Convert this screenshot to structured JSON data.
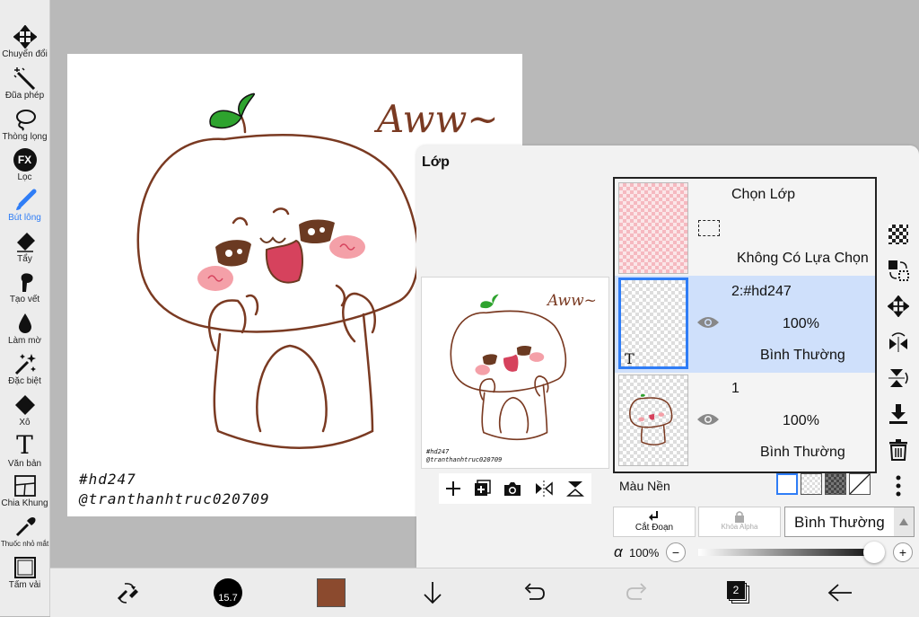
{
  "toolbar": {
    "items": [
      {
        "label": "Chuyển đổi",
        "icon": "move-icon"
      },
      {
        "label": "Đũa phép",
        "icon": "magic-wand-icon"
      },
      {
        "label": "Thòng lọng",
        "icon": "lasso-icon"
      },
      {
        "label": "Lọc",
        "icon": "fx-filter-icon"
      },
      {
        "label": "Bút lông",
        "icon": "brush-icon",
        "active": true
      },
      {
        "label": "Tẩy",
        "icon": "eraser-icon"
      },
      {
        "label": "Tạo vết",
        "icon": "smudge-icon"
      },
      {
        "label": "Làm mờ",
        "icon": "blur-drop-icon"
      },
      {
        "label": "Đặc biệt",
        "icon": "special-sparkle-icon"
      },
      {
        "label": "Xô",
        "icon": "bucket-icon"
      },
      {
        "label": "Văn bản",
        "icon": "text-icon"
      },
      {
        "label": "Chia Khung",
        "icon": "frame-divider-icon"
      },
      {
        "label": "Thuốc nhỏ mắt",
        "icon": "eyedropper-icon"
      },
      {
        "label": "Tấm vải",
        "icon": "canvas-icon"
      }
    ],
    "fx_text": "FX",
    "text_glyph": "T",
    "active_color": "#2f7df6"
  },
  "canvas": {
    "drawing_text": "Aww~",
    "signature_line1": "#hd247",
    "signature_line2": "@tranthanhtruc020709",
    "line_color": "#7a3a22",
    "leaf_color": "#2ea32e",
    "cheek_color": "#f4a0a8",
    "mouth_color": "#d6425d",
    "eye_color": "#6b3a22"
  },
  "layer_panel": {
    "title": "Lớp",
    "preview": {
      "drawing_text": "Aww~",
      "signature_line1": "#hd247",
      "signature_line2": "@tranthanhtruc020709"
    },
    "selection_row": {
      "title": "Chọn Lớp",
      "status": "Không Có Lựa Chọn"
    },
    "layers": [
      {
        "name": "2:#hd247",
        "opacity": "100%",
        "blend": "Bình Thường",
        "selected": true,
        "thumb_glyph": "T"
      },
      {
        "name": "1",
        "opacity": "100%",
        "blend": "Bình Thường",
        "selected": false
      }
    ],
    "background_label": "Màu Nền",
    "clip_label": "Cắt Đoạn",
    "alpha_lock_label": "Khóa Alpha",
    "blend_mode": "Bình Thường",
    "alpha_symbol": "α",
    "alpha_value": "100%",
    "alpha_level": 1.0,
    "minus": "−",
    "plus": "+"
  },
  "bottom_bar": {
    "brush_size": "15.7",
    "color": "#8b4a2e",
    "layer_count": "2"
  }
}
